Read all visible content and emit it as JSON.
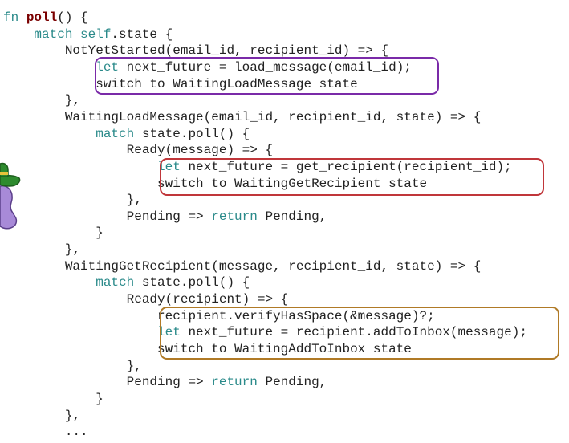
{
  "colors": {
    "keyword": "#2a8a8a",
    "fn_name": "#7a0000",
    "plain": "#222222",
    "box_purple": "#7a2aa8",
    "box_red": "#c0363a",
    "box_orange": "#b07a26",
    "mascot_hat": "#2e8b2e",
    "mascot_body": "#a88ad8"
  },
  "mascot": {
    "icon": "ferris-crab-with-hat-icon"
  },
  "highlight_boxes": [
    {
      "name": "load-message-box",
      "color": "box_purple"
    },
    {
      "name": "get-recipient-box",
      "color": "box_red"
    },
    {
      "name": "add-to-inbox-box",
      "color": "box_orange"
    }
  ],
  "code": {
    "lines": [
      [
        {
          "t": "fn ",
          "c": "kw"
        },
        {
          "t": "poll",
          "c": "fn"
        },
        {
          "t": "() {",
          "c": "plain"
        }
      ],
      [
        {
          "t": "    ",
          "c": "plain"
        },
        {
          "t": "match self",
          "c": "kw"
        },
        {
          "t": ".state {",
          "c": "plain"
        }
      ],
      [
        {
          "t": "        NotYetStarted(email_id, recipient_id) => {",
          "c": "plain"
        }
      ],
      [
        {
          "t": "            ",
          "c": "plain"
        },
        {
          "t": "let",
          "c": "kw"
        },
        {
          "t": " next_future = load_message(email_id);",
          "c": "plain"
        }
      ],
      [
        {
          "t": "            switch to WaitingLoadMessage state",
          "c": "plain"
        }
      ],
      [
        {
          "t": "        },",
          "c": "plain"
        }
      ],
      [
        {
          "t": "        WaitingLoadMessage(email_id, recipient_id, state) => {",
          "c": "plain"
        }
      ],
      [
        {
          "t": "            ",
          "c": "plain"
        },
        {
          "t": "match",
          "c": "kw"
        },
        {
          "t": " state.poll() {",
          "c": "plain"
        }
      ],
      [
        {
          "t": "                Ready(message) => {",
          "c": "plain"
        }
      ],
      [
        {
          "t": "                    ",
          "c": "plain"
        },
        {
          "t": "let",
          "c": "kw"
        },
        {
          "t": " next_future = get_recipient(recipient_id);",
          "c": "plain"
        }
      ],
      [
        {
          "t": "                    switch to WaitingGetRecipient state",
          "c": "plain"
        }
      ],
      [
        {
          "t": "                },",
          "c": "plain"
        }
      ],
      [
        {
          "t": "                Pending => ",
          "c": "plain"
        },
        {
          "t": "return",
          "c": "kw"
        },
        {
          "t": " Pending,",
          "c": "plain"
        }
      ],
      [
        {
          "t": "            }",
          "c": "plain"
        }
      ],
      [
        {
          "t": "        },",
          "c": "plain"
        }
      ],
      [
        {
          "t": "        WaitingGetRecipient(message, recipient_id, state) => {",
          "c": "plain"
        }
      ],
      [
        {
          "t": "            ",
          "c": "plain"
        },
        {
          "t": "match",
          "c": "kw"
        },
        {
          "t": " state.poll() {",
          "c": "plain"
        }
      ],
      [
        {
          "t": "                Ready(recipient) => {",
          "c": "plain"
        }
      ],
      [
        {
          "t": "                    recipient.verifyHasSpace(&message)?;",
          "c": "plain"
        }
      ],
      [
        {
          "t": "                    ",
          "c": "plain"
        },
        {
          "t": "let",
          "c": "kw"
        },
        {
          "t": " next_future = recipient.addToInbox(message);",
          "c": "plain"
        }
      ],
      [
        {
          "t": "                    switch to WaitingAddToInbox state",
          "c": "plain"
        }
      ],
      [
        {
          "t": "                },",
          "c": "plain"
        }
      ],
      [
        {
          "t": "                Pending => ",
          "c": "plain"
        },
        {
          "t": "return",
          "c": "kw"
        },
        {
          "t": " Pending,",
          "c": "plain"
        }
      ],
      [
        {
          "t": "            }",
          "c": "plain"
        }
      ],
      [
        {
          "t": "        },",
          "c": "plain"
        }
      ],
      [
        {
          "t": "        ...",
          "c": "plain"
        }
      ]
    ]
  }
}
